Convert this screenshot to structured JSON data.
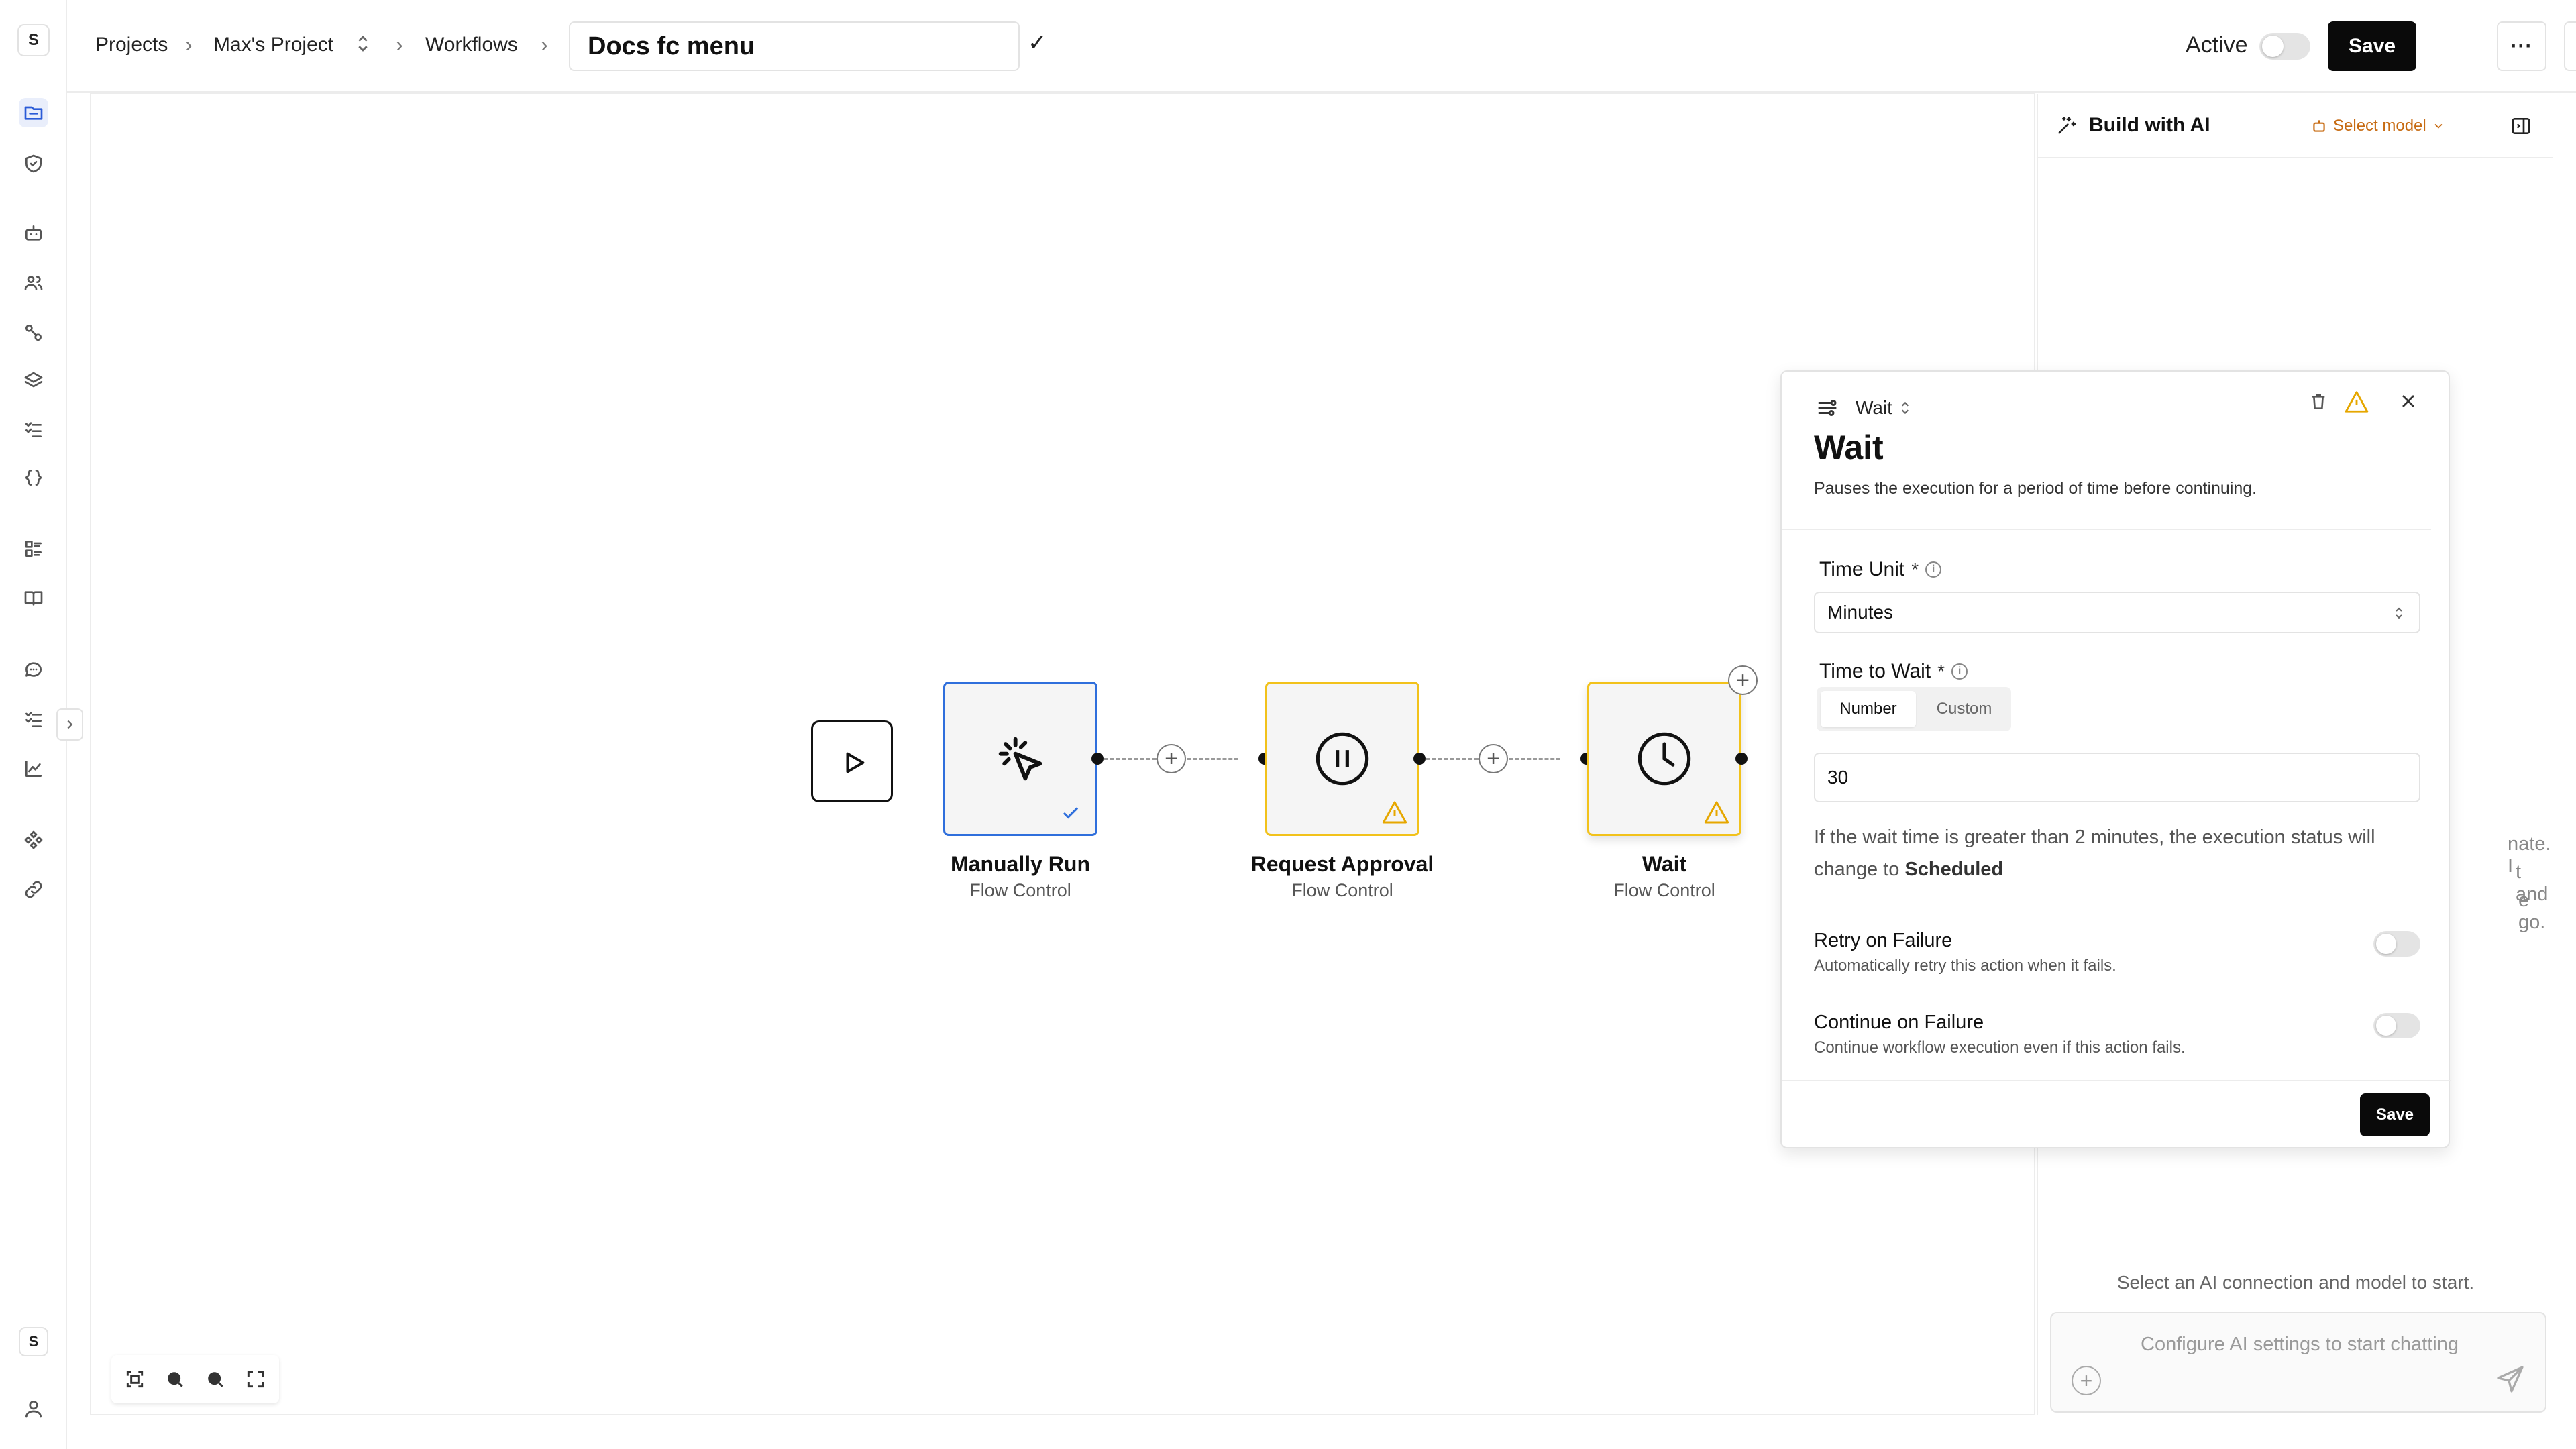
{
  "rail": {
    "workspace_badge": "S",
    "user_badge": "S"
  },
  "breadcrumb": {
    "projects": "Projects",
    "project": "Max's Project",
    "workflows": "Workflows",
    "separator": "›"
  },
  "workflow": {
    "name": "Docs fc menu"
  },
  "topbar": {
    "confirm_glyph": "✓",
    "active_label": "Active",
    "active_on": false,
    "save_label": "Save",
    "more_glyph": "···"
  },
  "nodes": [
    {
      "title": "Manually Run",
      "subtitle": "Flow Control",
      "icon": "cursor-click-icon",
      "status": "valid"
    },
    {
      "title": "Request Approval",
      "subtitle": "Flow Control",
      "icon": "pause-circle-icon",
      "status": "warning"
    },
    {
      "title": "Wait",
      "subtitle": "Flow Control",
      "icon": "clock-icon",
      "status": "warning"
    }
  ],
  "ai": {
    "title": "Build with AI",
    "model_label": "Select model",
    "hint": "Select an AI connection and model to start.",
    "input_placeholder": "Configure AI settings to start chatting",
    "hidden_text_fragments": [
      "nate. I",
      "t and",
      "e go."
    ]
  },
  "wait_panel": {
    "type_label": "Wait",
    "title": "Wait",
    "description": "Pauses the execution for a period of time before continuing.",
    "time_unit_label": "Time Unit",
    "required_marker": "*",
    "time_unit_value": "Minutes",
    "time_to_wait_label": "Time to Wait",
    "mode_number": "Number",
    "mode_custom": "Custom",
    "selected_mode": "Number",
    "time_to_wait_value": "30",
    "note_prefix": "If the wait time is greater than 2 minutes, the execution status will change to ",
    "note_status": "Scheduled",
    "retry_title": "Retry on Failure",
    "retry_desc": "Automatically retry this action when it fails.",
    "retry_on": false,
    "continue_title": "Continue on Failure",
    "continue_desc": "Continue workflow execution even if this action fails.",
    "continue_on": false,
    "save_label": "Save"
  },
  "colors": {
    "selected_node_border": "#2f6fdc",
    "warning_node_border": "#f2c21b",
    "warning_icon": "#e6a700",
    "primary_button": "#0a0a0a",
    "model_link": "#c76b12"
  }
}
